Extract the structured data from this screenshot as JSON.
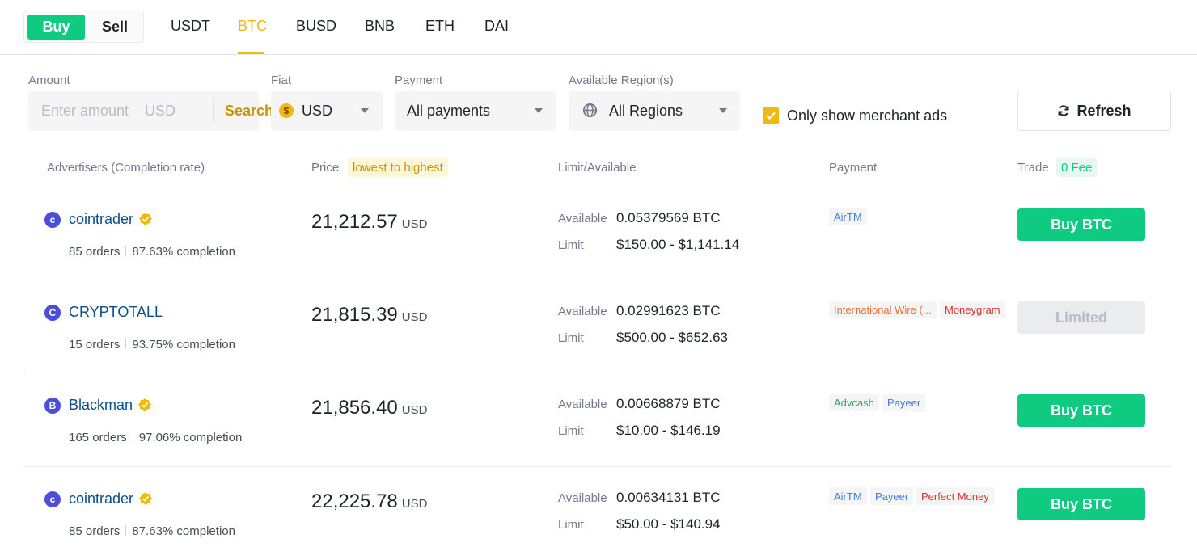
{
  "header": {
    "buy_label": "Buy",
    "sell_label": "Sell",
    "tabs": [
      "USDT",
      "BTC",
      "BUSD",
      "BNB",
      "ETH",
      "DAI"
    ],
    "active_tab": "BTC"
  },
  "filters": {
    "amount_label": "Amount",
    "amount_placeholder": "Enter amount",
    "amount_currency": "USD",
    "search_label": "Search",
    "fiat_label": "Fiat",
    "fiat_value": "USD",
    "fiat_icon_text": "$",
    "payment_label": "Payment",
    "payment_value": "All payments",
    "region_label": "Available Region(s)",
    "region_value": "All Regions",
    "merchant_only_label": "Only show merchant ads",
    "merchant_only_checked": true,
    "refresh_label": "Refresh"
  },
  "table": {
    "col_advertisers": "Advertisers (Completion rate)",
    "col_price": "Price",
    "price_sort_badge": "lowest to highest",
    "col_limit": "Limit/Available",
    "col_payment": "Payment",
    "col_trade": "Trade",
    "trade_fee_badge": "0 Fee",
    "available_label": "Available",
    "limit_label": "Limit",
    "price_unit": "USD",
    "rows": [
      {
        "avatar": "c",
        "name": "cointrader",
        "verified": true,
        "orders": "85 orders",
        "completion": "87.63% completion",
        "price": "21,212.57",
        "available": "0.05379569 BTC",
        "limit": "$150.00 - $1,141.14",
        "payments": [
          {
            "label": "AirTM",
            "color": "#3d7de4"
          }
        ],
        "action": "Buy BTC",
        "action_enabled": true
      },
      {
        "avatar": "C",
        "name": "CRYPTOTALL",
        "verified": false,
        "orders": "15 orders",
        "completion": "93.75% completion",
        "price": "21,815.39",
        "available": "0.02991623 BTC",
        "limit": "$500.00 - $652.63",
        "payments": [
          {
            "label": "International Wire (...",
            "color": "#e8703a"
          },
          {
            "label": "Moneygram",
            "color": "#d9302b"
          }
        ],
        "action": "Limited",
        "action_enabled": false
      },
      {
        "avatar": "B",
        "name": "Blackman",
        "verified": true,
        "orders": "165 orders",
        "completion": "97.06% completion",
        "price": "21,856.40",
        "available": "0.00668879 BTC",
        "limit": "$10.00 - $146.19",
        "payments": [
          {
            "label": "Advcash",
            "color": "#2ea26b"
          },
          {
            "label": "Payeer",
            "color": "#3d7de4"
          }
        ],
        "action": "Buy BTC",
        "action_enabled": true
      },
      {
        "avatar": "c",
        "name": "cointrader",
        "verified": true,
        "orders": "85 orders",
        "completion": "87.63% completion",
        "price": "22,225.78",
        "available": "0.00634131 BTC",
        "limit": "$50.00 - $140.94",
        "payments": [
          {
            "label": "AirTM",
            "color": "#3d7de4"
          },
          {
            "label": "Payeer",
            "color": "#3d7de4"
          },
          {
            "label": "Perfect Money",
            "color": "#d9302b"
          }
        ],
        "action": "Buy BTC",
        "action_enabled": true
      }
    ]
  },
  "colors": {
    "accent": "#f0b90b",
    "buy_green": "#0ecb81",
    "advertiser_link": "#0b4c8c"
  }
}
